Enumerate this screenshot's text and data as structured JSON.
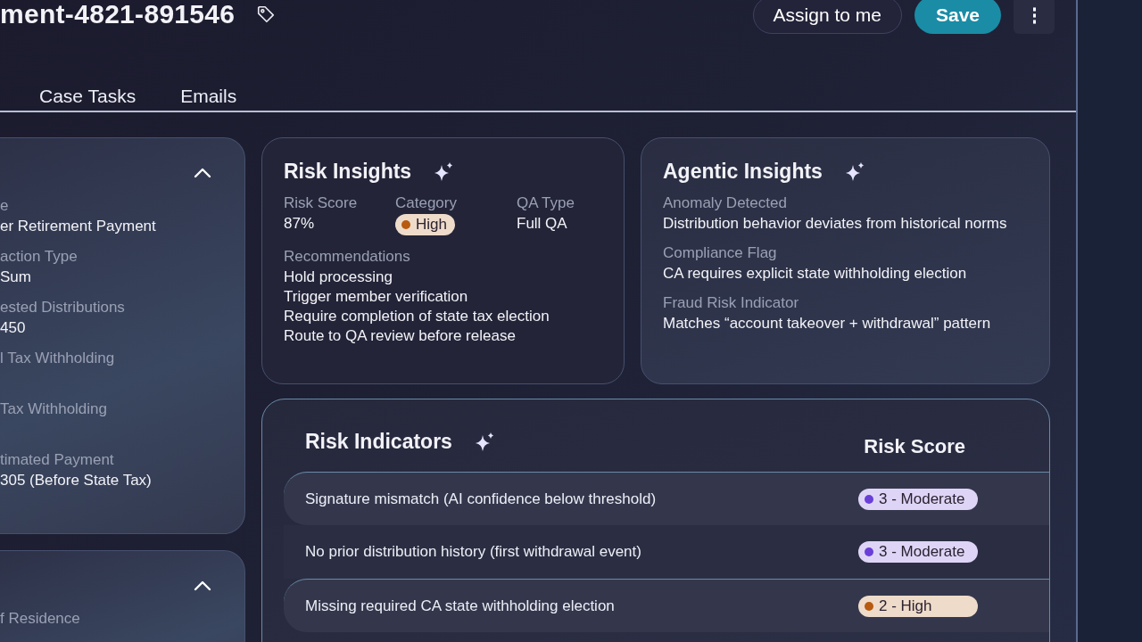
{
  "header": {
    "title": "ment-4821-891546",
    "buttons": [
      {
        "label": "Assign to me",
        "kind": "secondary"
      },
      {
        "label": "Save",
        "kind": "primary"
      },
      {
        "label": "⋮",
        "kind": "more"
      }
    ]
  },
  "tabs": [
    {
      "label": "Case Tasks",
      "selected": false
    },
    {
      "label": "Emails",
      "selected": false
    }
  ],
  "details_cards": [
    {
      "expanded": true,
      "fields": [
        {
          "label": "e",
          "value": "er Retirement Payment"
        },
        {
          "label": "action Type",
          "value": "Sum"
        },
        {
          "label": "ested Distributions",
          "value": "450"
        },
        {
          "label": "l Tax Withholding"
        },
        {
          "label": "Tax Withholding"
        },
        {
          "label": "timated Payment",
          "value": "305 (Before State Tax)"
        }
      ]
    },
    {
      "expanded": true,
      "fields": [
        {
          "label": "f Residence"
        }
      ]
    }
  ],
  "risk_insights": {
    "title": "Risk Insights",
    "risk_score": {
      "label": "Risk Score",
      "value": "87%"
    },
    "category": {
      "label": "Category",
      "value": "High",
      "color": "#b85a10"
    },
    "qa_type": {
      "label": "QA Type",
      "value": "Full QA"
    },
    "recommendations_label": "Recommendations",
    "recommendations": [
      "Hold processing",
      "Trigger member verification",
      "Require completion of state tax election",
      "Route to QA review before release"
    ]
  },
  "agentic_insights": {
    "title": "Agentic Insights",
    "items": [
      {
        "label": "Anomaly Detected",
        "value": "Distribution behavior deviates from historical norms"
      },
      {
        "label": "Compliance Flag",
        "value": "CA requires explicit state withholding election"
      },
      {
        "label": "Fraud Risk Indicator",
        "value": "Matches “account takeover + withdrawal” pattern"
      }
    ]
  },
  "risk_indicators": {
    "title": "Risk Indicators",
    "score_heading": "Risk Score",
    "rows": [
      {
        "text": "Signature mismatch (AI confidence below threshold)",
        "score": "3 - Moderate",
        "color": "#6a3fd8"
      },
      {
        "text": "No prior distribution history (first withdrawal event)",
        "score": "3 - Moderate",
        "color": "#6a3fd8"
      },
      {
        "text": "Missing required CA state withholding election",
        "score": "2 - High",
        "color": "#b85a10"
      }
    ]
  }
}
